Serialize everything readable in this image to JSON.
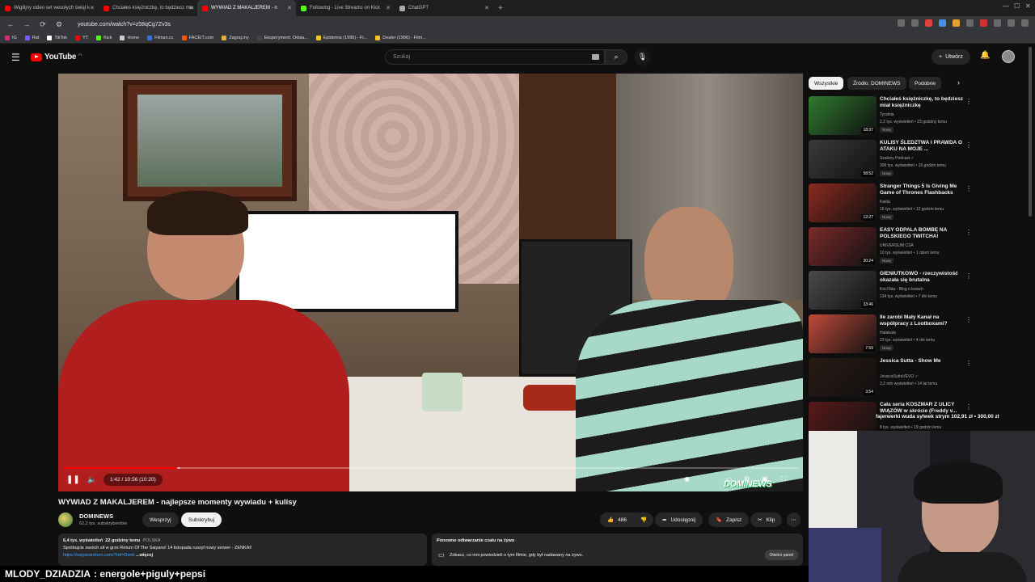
{
  "browser": {
    "tabs": [
      {
        "title": "Wigilijny video set wesołych świąt k",
        "color": "#ff0000",
        "active": false
      },
      {
        "title": "Chciałeś księżniczkę, to będziesz mia",
        "color": "#ff0000",
        "active": false
      },
      {
        "title": "WYWIAD Z MAKALJEREM - n",
        "color": "#ff0000",
        "active": true
      },
      {
        "title": "Following - Live Streams on Kick",
        "color": "#53fc18",
        "active": false
      },
      {
        "title": "ChatGPT",
        "color": "#aaaaaa",
        "active": false
      }
    ],
    "url": "youtube.com/watch?v=z58qCg7Zv3s",
    "bookmarks": [
      {
        "label": "IG",
        "color": "#d62976"
      },
      {
        "label": "Rat",
        "color": "#7a5cff"
      },
      {
        "label": "TikTok",
        "color": "#ffffff"
      },
      {
        "label": "YT",
        "color": "#ff0000"
      },
      {
        "label": "Kick",
        "color": "#53fc18"
      },
      {
        "label": "Home",
        "color": "#cccccc"
      },
      {
        "label": "Filman.cc",
        "color": "#3a6fd8"
      },
      {
        "label": "FACEIT.com",
        "color": "#ff5500"
      },
      {
        "label": "Zagraj.my",
        "color": "#e0b030"
      },
      {
        "label": "Eksperyment: Odsia...",
        "color": "#444444"
      },
      {
        "label": "Epidemia (1995) - Fi...",
        "color": "#f5c518"
      },
      {
        "label": "Dealer (1996) - Film...",
        "color": "#f5c518"
      }
    ]
  },
  "header": {
    "logo_text": "YouTube",
    "region": "PL",
    "search_placeholder": "Szukaj",
    "create_label": "Utwórz"
  },
  "player": {
    "time_label": "1:42 / 10:56 (10:20)",
    "progress": 0.155,
    "buffer": 0.16,
    "watermark": "DOMINEWS"
  },
  "video": {
    "title": "WYWIAD Z MAKALJEREM - najlepsze momenty wywiadu + kulisy",
    "channel": "DOMINEWS",
    "subs": "62,2 tys. subskrybentów",
    "support_label": "Wesprzyj",
    "subscribe_label": "Subskrybuj",
    "likes": "486",
    "share_label": "Udostępnij",
    "save_label": "Zapisz",
    "clip_label": "Klip",
    "desc_views": "6,4 tys. wyświetleń",
    "desc_time": "22 godziny temu",
    "desc_tag": "POLSKA",
    "desc_line": "Spróbujcie swoich sił w grze Return Of The Saiyans! 14 listopada ruszył nowy serwer  - ZENKAI!",
    "desc_link": "https://saiyansreturn.com/?ref=Domi",
    "desc_more": "...więcej",
    "replay_title": "Ponowne odtwarzanie czatu na żywo",
    "replay_text": "Zobacz, co inni powiedzieli o tym filmie, gdy był nadawany na żywo.",
    "replay_open": "Otwórz panel"
  },
  "sidebar": {
    "chips": [
      "Wszystkie",
      "Źródło: DOMINEWS",
      "Podobne"
    ],
    "items": [
      {
        "title": "Chciałeś księżniczkę, to będziesz miał księżniczkę",
        "channel": "Tyralnia",
        "meta": "2,2 tys. wyświetleń • 23 godziny temu",
        "badge": "Nowy",
        "duration": "18:37",
        "thumb": "#2f7a2f"
      },
      {
        "title": "KULISY ŚLEDZTWA I PRAWDA O ATAKU NA MOJE ...",
        "channel": "Szalony Podcast ✓",
        "meta": "306 tys. wyświetleń • 16 godzin temu",
        "badge": "Nowy",
        "duration": "58:52",
        "thumb": "#3a3a3a"
      },
      {
        "title": "Stranger Things 5 Is Giving Me Game of Thrones Flashbacks",
        "channel": "Kaida",
        "meta": "16 tys. wyświetleń • 12 godzin temu",
        "badge": "Nowy",
        "duration": "12:27",
        "thumb": "#8a2a1f"
      },
      {
        "title": "EASY ODPALA BOMBĘ NA POLSKIEGO TWITCHA!",
        "channel": "UNIVERSUM CSA",
        "meta": "10 tys. wyświetleń • 1 dzień temu",
        "badge": "Nowy",
        "duration": "30:24",
        "thumb": "#7a2a2a"
      },
      {
        "title": "GIENIUTKOWO - rzeczywistość okazała się brutalna",
        "channel": "KociTata - Blog o kotach",
        "meta": "134 tys. wyświetleń • 7 dni temu",
        "badge": "",
        "duration": "33:46",
        "thumb": "#4a4a4a"
      },
      {
        "title": "Ile zarobi Mały Kanał na współpracy z Lootboxami?",
        "channel": "Halabala",
        "meta": "23 tys. wyświetleń • 4 dni temu",
        "badge": "Nowy",
        "duration": "7:59",
        "thumb": "#c04a3a"
      },
      {
        "title": "Jessica Sutta - Show Me",
        "channel": "JessicaSuttaVEVO ✓",
        "meta": "3,2 mln wyświetleń • 14 lat temu",
        "badge": "",
        "duration": "3:54",
        "thumb": "#2a1a14"
      },
      {
        "title": "Cała seria KOSZMAR Z ULICY WIĄZÓW w skrócie (Freddy v...",
        "channel": "",
        "meta": "8 tys. wyświetleń • 19 godzin temu",
        "badge": "",
        "duration": "",
        "thumb": "#5a1a1a"
      }
    ]
  },
  "overlay": {
    "donation": "fajerwerki wuda sylwek strym 102,91 zł  •  300,00 zł",
    "chat_user": "MLODY_DZIADZIA",
    "chat_message": ": energole+piguly+pepsi"
  }
}
